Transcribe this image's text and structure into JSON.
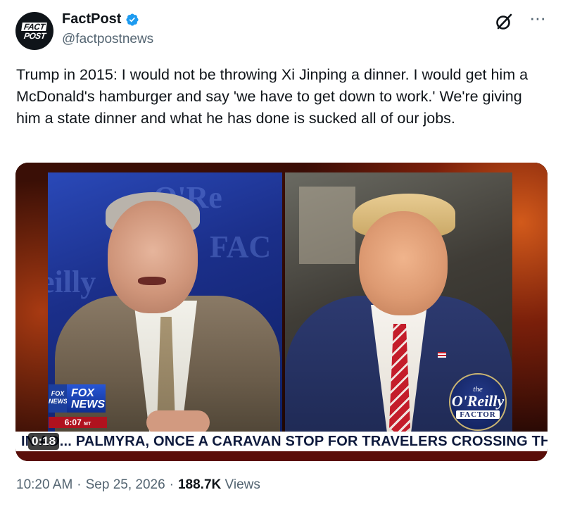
{
  "account": {
    "avatar_text_top": "FACT",
    "avatar_text_bottom": "POST",
    "display_name": "FactPost",
    "handle": "@factpostnews",
    "verified": true,
    "verified_color": "#1d9bf0"
  },
  "header_icons": {
    "grok": "grok-icon",
    "more": "more-icon",
    "more_glyph": "···"
  },
  "tweet": {
    "text": "Trump in 2015: I would not be throwing Xi Jinping a dinner. I would get him a McDonald's hamburger and say 'we have to get down to work.' We're giving him a state dinner and what he has done is sucked all of our jobs."
  },
  "video": {
    "elapsed": "0:18",
    "ticker_text": "IN AD... PALMYRA, ONCE A CARAVAN STOP FOR TRAVELERS CROSSING TH",
    "fox_small": "FOX NEWS",
    "fox_big_line1": "FOX",
    "fox_big_line2": "NEWS",
    "fox_time": "6:07",
    "fox_time_suffix": "MT",
    "show_logo_the": "the",
    "show_logo_name": "O'Reilly",
    "show_logo_factor": "FACTOR"
  },
  "meta": {
    "time": "10:20 AM",
    "separator": "·",
    "date": "Sep 25, 2026",
    "views": "188.7K",
    "views_label": "Views"
  },
  "colors": {
    "text_primary": "#0f1419",
    "text_secondary": "#536471",
    "verified_blue": "#1d9bf0"
  }
}
